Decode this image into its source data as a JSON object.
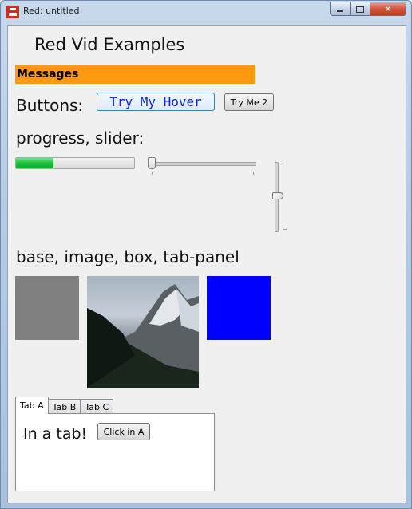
{
  "window": {
    "title": "Red: untitled",
    "app_icon": "red-logo-icon",
    "controls": {
      "minimize_icon": "minimize-icon",
      "maximize_icon": "maximize-icon",
      "close_glyph": "✕"
    }
  },
  "content": {
    "heading": "Red Vid Examples",
    "messages_label": "Messages",
    "buttons_label": "Buttons:",
    "button_hover_label": "Try My Hover",
    "button_two_label": "Try Me 2",
    "progress_slider_label": "progress, slider:",
    "progress_value": 0.32,
    "hslider_value": 0.0,
    "vslider_value": 0.5,
    "base_label": "base, image, box, tab-panel",
    "base_color": "#808080",
    "box_color": "#0000ff",
    "messages_color": "#ff9a10",
    "tabs": [
      {
        "label": "Tab A",
        "active": true
      },
      {
        "label": "Tab B",
        "active": false
      },
      {
        "label": "Tab C",
        "active": false
      }
    ],
    "tab_text": "In a tab!",
    "tab_button_label": "Click in A"
  }
}
